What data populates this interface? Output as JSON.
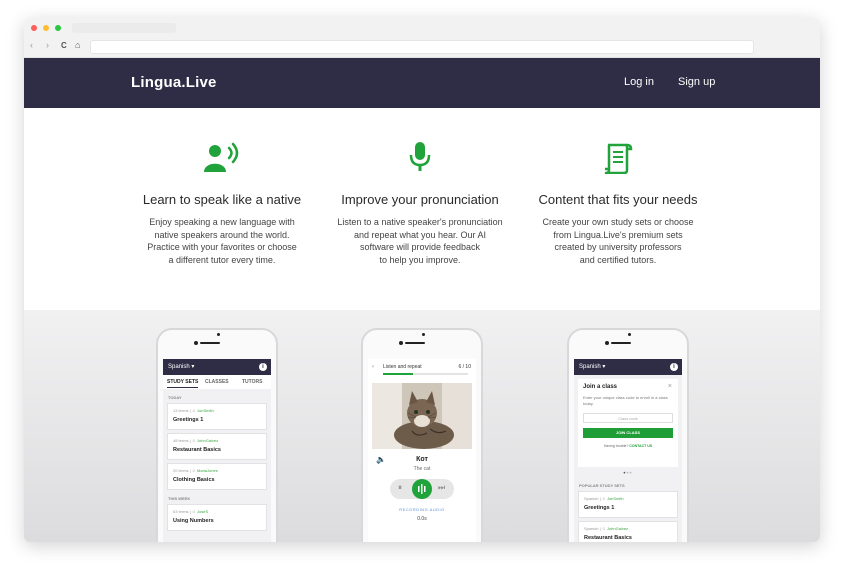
{
  "browser": {
    "nav_back": "‹",
    "nav_fwd": "›",
    "reload": "C",
    "home": "⌂"
  },
  "header": {
    "logo": "Lingua.Live",
    "login": "Log in",
    "signup": "Sign up"
  },
  "features": [
    {
      "icon": "speaker-icon",
      "title": "Learn to speak like a native",
      "lines": [
        "Enjoy speaking a new language with",
        "native speakers around the world.",
        "Practice with your favorites or choose",
        "a different tutor every time."
      ]
    },
    {
      "icon": "microphone-icon",
      "title": "Improve your pronunciation",
      "lines": [
        "Listen to a native speaker's pronunciation",
        "and repeat what you hear. Our AI",
        "software will provide feedback",
        "to help you improve."
      ]
    },
    {
      "icon": "document-icon",
      "title": "Content that fits your needs",
      "lines": [
        "Create your own study sets or choose",
        "from Lingua.Live's premium sets",
        "created by university professors",
        "and certified tutors."
      ]
    }
  ],
  "phone1": {
    "language": "Spanish",
    "tabs": [
      "STUDY SETS",
      "CLASSES",
      "TUTORS"
    ],
    "today_label": "TODAY",
    "this_week_label": "THIS WEEK",
    "cards": [
      {
        "terms": "13 terms",
        "author": "JonSmith",
        "name": "Greetings 1"
      },
      {
        "terms": "48 terms",
        "author": "JohnGalvez",
        "name": "Restaurant Basics"
      },
      {
        "terms": "20 terms",
        "author": "MariaJones",
        "name": "Clothing Basics"
      },
      {
        "terms": "63 terms",
        "author": "JoseS",
        "name": "Using Numbers"
      }
    ]
  },
  "phone2": {
    "title": "Listen and repeat",
    "progress_text": "6 / 10",
    "progress": 0.35,
    "word": "Кот",
    "translation": "The cat",
    "recording_label": "RECORDING AUDIO",
    "time": "0.0s"
  },
  "phone3": {
    "language": "Spanish",
    "modal_title": "Join a class",
    "modal_desc": "Enter your unique class code to enroll in a class today.",
    "input_placeholder": "Class code",
    "join_button": "JOIN CLASS",
    "trouble_text": "Having trouble?",
    "contact_text": "CONTACT US",
    "popular_label": "POPULAR STUDY SETS",
    "cards": [
      {
        "lang": "Spanish",
        "author": "JonSmith",
        "name": "Greetings 1"
      },
      {
        "lang": "Spanish",
        "author": "JohnGalvez",
        "name": "Restaurant Basics"
      }
    ]
  },
  "colors": {
    "header_bg": "#2f2d45",
    "accent_green": "#20a33a"
  }
}
